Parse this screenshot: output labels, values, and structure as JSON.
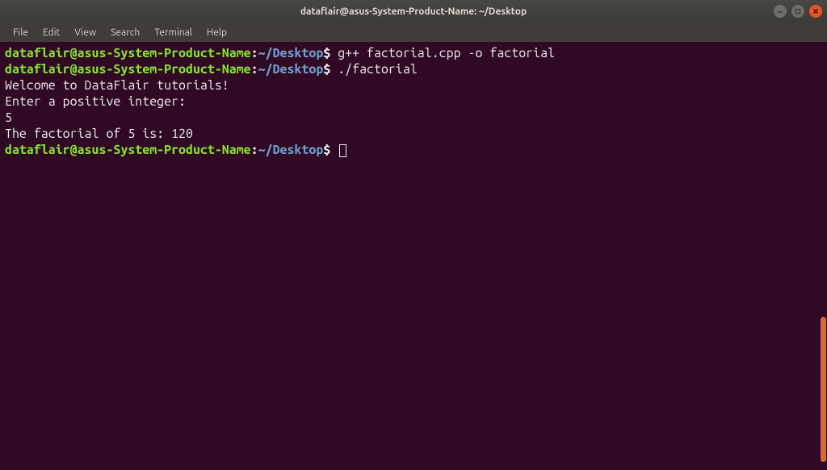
{
  "titlebar": {
    "title": "dataflair@asus-System-Product-Name: ~/Desktop"
  },
  "menubar": {
    "items": [
      "File",
      "Edit",
      "View",
      "Search",
      "Terminal",
      "Help"
    ]
  },
  "prompt": {
    "user_host": "dataflair@asus-System-Product-Name",
    "colon": ":",
    "tilde": "~",
    "path": "/Desktop",
    "dollar": "$"
  },
  "lines": {
    "cmd1": " g++ factorial.cpp -o factorial",
    "cmd2": " ./factorial",
    "out1": "Welcome to DataFlair tutorials!",
    "blank": "",
    "out2": "Enter a positive integer:",
    "out3": "5",
    "out4": "The factorial of 5 is: 120",
    "cmd3": " "
  }
}
